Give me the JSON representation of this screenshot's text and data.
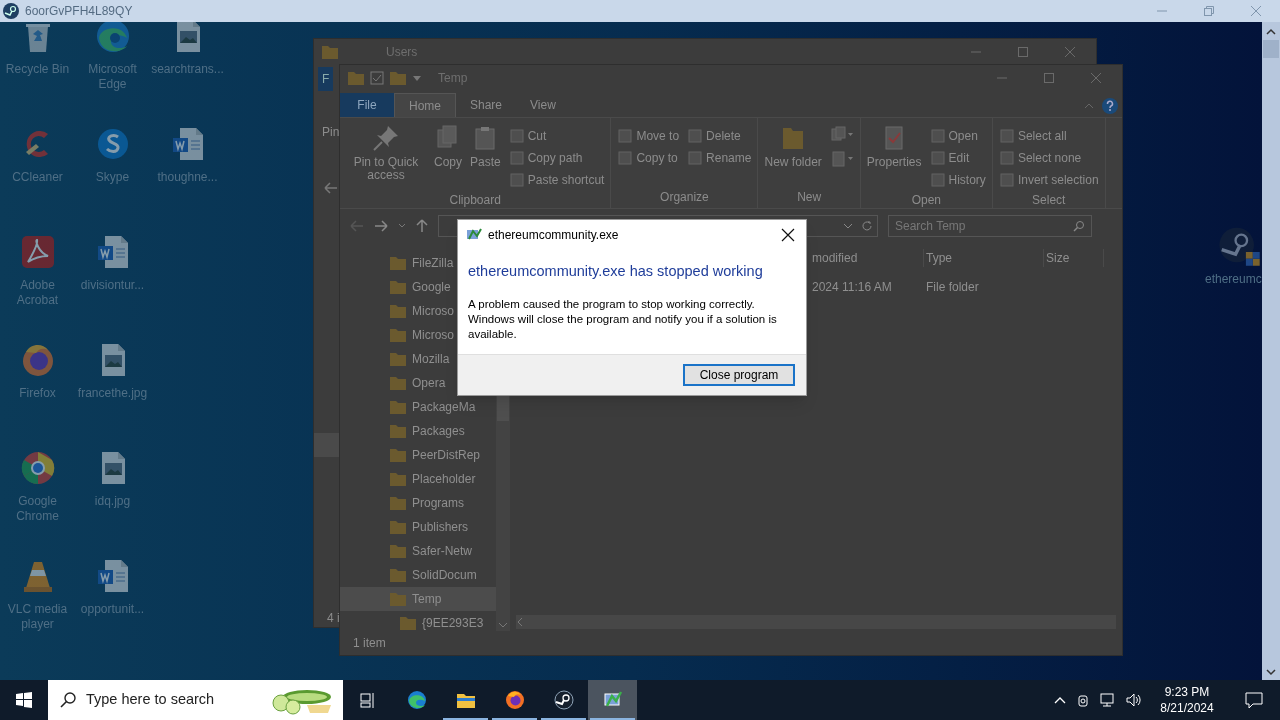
{
  "viewer": {
    "title": "6oorGvPFH4L89QY"
  },
  "desktop_columns": [
    [
      {
        "label": "Recycle Bin",
        "kind": "recycle"
      },
      {
        "label": "CCleaner",
        "kind": "ccleaner"
      },
      {
        "label": "Adobe Acrobat",
        "kind": "acrobat"
      },
      {
        "label": "Firefox",
        "kind": "firefox"
      },
      {
        "label": "Google Chrome",
        "kind": "chrome"
      },
      {
        "label": "VLC media player",
        "kind": "vlc"
      }
    ],
    [
      {
        "label": "Microsoft Edge",
        "kind": "edge"
      },
      {
        "label": "Skype",
        "kind": "skype"
      },
      {
        "label": "divisiontur...",
        "kind": "word"
      },
      {
        "label": "francethe.jpg",
        "kind": "image"
      },
      {
        "label": "idq.jpg",
        "kind": "image"
      },
      {
        "label": "opportunit...",
        "kind": "word"
      }
    ],
    [
      {
        "label": "searchtrans...",
        "kind": "image"
      },
      {
        "label": "thoughne...",
        "kind": "word"
      }
    ]
  ],
  "right_icon": {
    "label": "ethereumc",
    "kind": "steam"
  },
  "back_window": {
    "title": "Users",
    "file_tab": "F",
    "ribbon_text": "Pin",
    "status": "4 i"
  },
  "explorer": {
    "title": "Temp",
    "tabs": [
      {
        "label": "File",
        "kind": "file",
        "selected": false
      },
      {
        "label": "Home",
        "kind": "tab",
        "selected": true
      },
      {
        "label": "Share",
        "kind": "tab",
        "selected": false
      },
      {
        "label": "View",
        "kind": "tab",
        "selected": false
      }
    ],
    "ribbon": [
      {
        "name": "Clipboard",
        "large": [
          "Pin to Quick access",
          "Copy",
          "Paste"
        ],
        "small": [
          [
            "Cut",
            "Copy path",
            "Paste shortcut"
          ]
        ]
      },
      {
        "name": "Organize",
        "small": [
          [
            "Move to",
            "Copy to"
          ],
          [
            "Delete",
            "Rename"
          ]
        ]
      },
      {
        "name": "New",
        "large": [
          "New folder"
        ]
      },
      {
        "name": "Open",
        "large": [
          "Properties"
        ],
        "small": [
          [
            "Open",
            "Edit",
            "History"
          ]
        ]
      },
      {
        "name": "Select",
        "small": [
          [
            "Select all",
            "Select none",
            "Invert selection"
          ]
        ]
      }
    ],
    "search": {
      "placeholder": "Search Temp"
    },
    "nav": [
      {
        "label": "FileZilla",
        "selected": false
      },
      {
        "label": "Google",
        "selected": false
      },
      {
        "label": "Microso",
        "selected": false
      },
      {
        "label": "Microso",
        "selected": false
      },
      {
        "label": "Mozilla",
        "selected": false
      },
      {
        "label": "Opera",
        "selected": false
      },
      {
        "label": "PackageMa",
        "selected": false
      },
      {
        "label": "Packages",
        "selected": false
      },
      {
        "label": "PeerDistRep",
        "selected": false
      },
      {
        "label": "Placeholder",
        "selected": false
      },
      {
        "label": "Programs",
        "selected": false
      },
      {
        "label": "Publishers",
        "selected": false
      },
      {
        "label": "Safer-Netw",
        "selected": false
      },
      {
        "label": "SolidDocum",
        "selected": false
      },
      {
        "label": "Temp",
        "selected": true,
        "children": [
          {
            "label": "{9EE293E3",
            "selected": false
          }
        ]
      }
    ],
    "columns": [
      "modified",
      "Type",
      "Size"
    ],
    "rows": [
      [
        "2024 11:16 AM",
        "File folder"
      ]
    ],
    "status": "1 item"
  },
  "dialog": {
    "title": "ethereumcommunity.exe",
    "heading": "ethereumcommunity.exe has stopped working",
    "message": "A problem caused the program to stop working correctly. Windows will close the program and notify you if a solution is available.",
    "button": "Close program"
  },
  "taskbar": {
    "search_placeholder": "Type here to search",
    "apps": [
      {
        "kind": "taskview",
        "running": false,
        "selected": false
      },
      {
        "kind": "edge",
        "running": false,
        "selected": false
      },
      {
        "kind": "explorer",
        "running": true,
        "selected": false
      },
      {
        "kind": "firefox",
        "running": true,
        "selected": false
      },
      {
        "kind": "steam",
        "running": true,
        "selected": false
      },
      {
        "kind": "app",
        "running": true,
        "selected": true
      }
    ],
    "time": "9:23 PM",
    "date": "8/21/2024"
  }
}
